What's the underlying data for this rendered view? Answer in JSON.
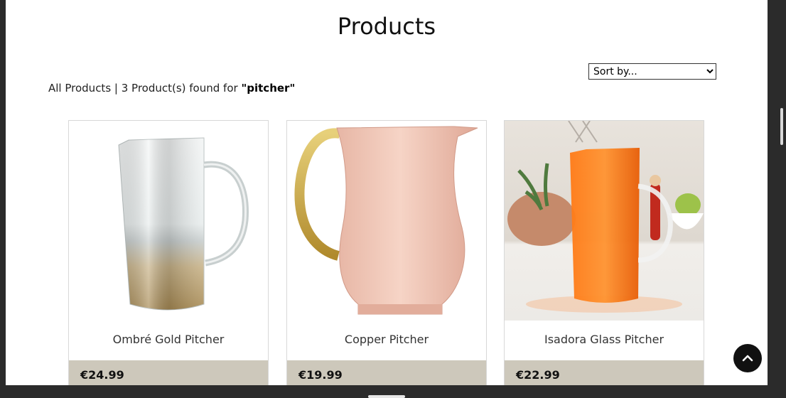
{
  "page": {
    "title": "Products"
  },
  "sort": {
    "selected": "Sort by..."
  },
  "results": {
    "prefix": "All Products | 3 Product(s) found for ",
    "query": "\"pitcher\""
  },
  "products": [
    {
      "name": "Ombré Gold Pitcher",
      "price": "€24.99"
    },
    {
      "name": "Copper Pitcher",
      "price": "€19.99"
    },
    {
      "name": "Isadora Glass Pitcher",
      "price": "€22.99"
    }
  ],
  "icons": {
    "back_to_top": "chevron-up-icon"
  },
  "colors": {
    "price_bar": "#cdc8bb",
    "back_to_top_bg": "#111111"
  }
}
